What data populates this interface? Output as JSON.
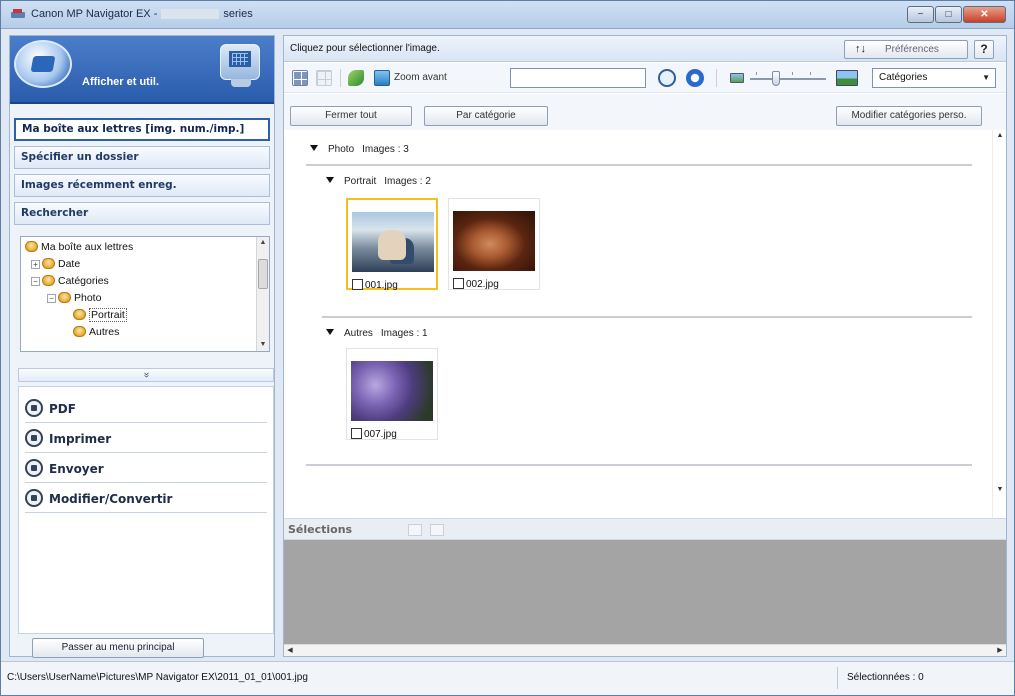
{
  "window": {
    "title_prefix": "Canon MP Navigator EX -",
    "title_suffix": "series",
    "controls": [
      "−",
      "□",
      "✕"
    ]
  },
  "left": {
    "hero_label": "Afficher et util.",
    "nav": [
      "Ma boîte aux lettres [img. num./imp.]",
      "Spécifier un dossier",
      "Images récemment enreg.",
      "Rechercher"
    ],
    "tree": {
      "root": "Ma boîte aux lettres",
      "date": "Date",
      "categories": "Catégories",
      "photo": "Photo",
      "portrait": "Portrait",
      "autres": "Autres"
    },
    "collapse_glyph": "»",
    "actions": [
      "PDF",
      "Imprimer",
      "Envoyer",
      "Modifier/Convertir"
    ],
    "main_menu_button": "Passer au menu principal"
  },
  "right": {
    "instruction": "Cliquez pour sélectionner l'image.",
    "preferences_icon": "↑↓",
    "preferences_label": "Préférences",
    "help_label": "?",
    "toolbar": {
      "zoom_label": "Zoom avant",
      "search_value": "",
      "category_select": "Catégories"
    },
    "filters": {
      "close_all": "Fermer tout",
      "by_category": "Par catégorie",
      "edit_custom": "Modifier catégories perso."
    },
    "groups": {
      "photo": {
        "name": "Photo",
        "count": "Images : 3"
      },
      "portrait": {
        "name": "Portrait",
        "count": "Images : 2"
      },
      "autres": {
        "name": "Autres",
        "count": "Images : 1"
      }
    },
    "thumbnails": [
      {
        "file": "001.jpg",
        "selected": true
      },
      {
        "file": "002.jpg",
        "selected": false
      },
      {
        "file": "007.jpg",
        "selected": false
      }
    ],
    "selections_label": "Sélections"
  },
  "status": {
    "path": "C:\\Users\\UserName\\Pictures\\MP Navigator EX\\2011_01_01\\001.jpg",
    "selected_count": "Sélectionnées : 0"
  },
  "colors": {
    "accent": "#2a5cad",
    "selected_border": "#f3c01e",
    "tray": "#a4a4a4"
  },
  "icons": {
    "app": "scanner-icon",
    "hero_left": "view-and-use-icon",
    "hero_right": "monitor-icon",
    "actions": [
      "pdf-icon",
      "print-icon",
      "send-icon",
      "edit-convert-icon"
    ]
  }
}
